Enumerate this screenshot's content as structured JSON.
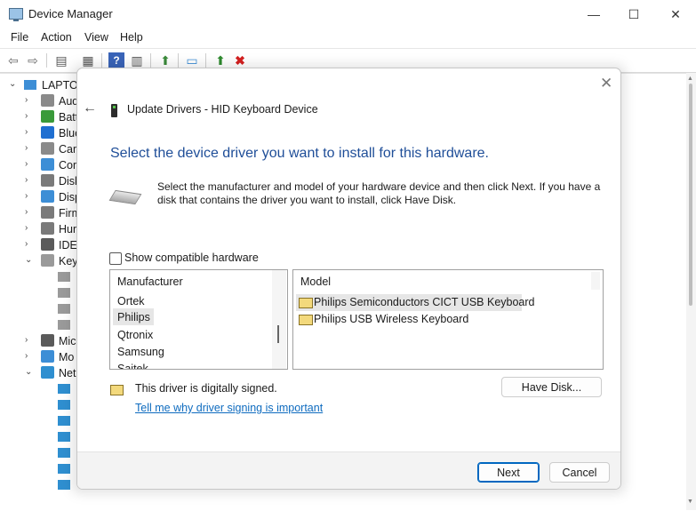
{
  "window": {
    "title": "Device Manager",
    "controls": {
      "minimize": "—",
      "maximize": "☐",
      "close": "✕"
    }
  },
  "menu": [
    {
      "label": "File"
    },
    {
      "label": "Action"
    },
    {
      "label": "View"
    },
    {
      "label": "Help"
    }
  ],
  "toolbar": [
    {
      "icon": "back-arrow-icon",
      "glyph": "⇦"
    },
    {
      "icon": "forward-arrow-icon",
      "glyph": "⇨"
    },
    {
      "icon": "properties-icon",
      "glyph": "▤"
    },
    {
      "icon": "list-icon",
      "glyph": "▦"
    },
    {
      "icon": "help-icon",
      "glyph": "?"
    },
    {
      "icon": "details-icon",
      "glyph": "▥"
    },
    {
      "icon": "update-driver-icon",
      "glyph": "⬆"
    },
    {
      "icon": "scan-hardware-icon",
      "glyph": "▭"
    },
    {
      "icon": "add-driver-icon",
      "glyph": "⬆"
    },
    {
      "icon": "uninstall-icon",
      "glyph": "✖"
    }
  ],
  "tree": {
    "root": {
      "label": "LAPTOP",
      "expander": "⌄"
    },
    "items": [
      {
        "label": "Aud",
        "expander": "›",
        "icon": "audio-icon",
        "color": "#8a8a8a"
      },
      {
        "label": "Batt",
        "expander": "›",
        "icon": "battery-icon",
        "color": "#3a9a3a"
      },
      {
        "label": "Blue",
        "expander": "›",
        "icon": "bluetooth-icon",
        "color": "#1f6fd1"
      },
      {
        "label": "Cam",
        "expander": "›",
        "icon": "camera-icon",
        "color": "#8a8a8a"
      },
      {
        "label": "Com",
        "expander": "›",
        "icon": "computer-icon",
        "color": "#3d8ed6"
      },
      {
        "label": "Disk",
        "expander": "›",
        "icon": "disk-icon",
        "color": "#7a7a7a"
      },
      {
        "label": "Disp",
        "expander": "›",
        "icon": "display-icon",
        "color": "#3d8ed6"
      },
      {
        "label": "Firm",
        "expander": "›",
        "icon": "firmware-icon",
        "color": "#7a7a7a"
      },
      {
        "label": "Hum",
        "expander": "›",
        "icon": "hid-icon",
        "color": "#7a7a7a"
      },
      {
        "label": "IDE",
        "expander": "›",
        "icon": "ide-icon",
        "color": "#5a5a5a"
      },
      {
        "label": "Key",
        "expander": "⌄",
        "icon": "keyboard-icon",
        "color": "#9a9a9a"
      },
      {
        "label": "",
        "expander": "",
        "icon": "keyboard-device-icon",
        "color": "#9a9a9a",
        "child": true
      },
      {
        "label": "",
        "expander": "",
        "icon": "keyboard-device-icon",
        "color": "#9a9a9a",
        "child": true
      },
      {
        "label": "",
        "expander": "",
        "icon": "keyboard-device-icon",
        "color": "#9a9a9a",
        "child": true
      },
      {
        "label": "",
        "expander": "",
        "icon": "keyboard-device-icon",
        "color": "#9a9a9a",
        "child": true
      },
      {
        "label": "Mic",
        "expander": "›",
        "icon": "mouse-icon",
        "color": "#5a5a5a"
      },
      {
        "label": "Mo",
        "expander": "›",
        "icon": "monitor-icon",
        "color": "#3d8ed6"
      },
      {
        "label": "Net",
        "expander": "⌄",
        "icon": "network-icon",
        "color": "#2f8fd0"
      },
      {
        "label": "",
        "expander": "",
        "icon": "network-adapter-icon",
        "color": "#2f8fd0",
        "child": true
      },
      {
        "label": "",
        "expander": "",
        "icon": "network-adapter-icon",
        "color": "#2f8fd0",
        "child": true
      },
      {
        "label": "",
        "expander": "",
        "icon": "network-adapter-icon",
        "color": "#2f8fd0",
        "child": true
      },
      {
        "label": "",
        "expander": "",
        "icon": "network-adapter-icon",
        "color": "#2f8fd0",
        "child": true
      },
      {
        "label": "",
        "expander": "",
        "icon": "network-adapter-icon",
        "color": "#2f8fd0",
        "child": true
      },
      {
        "label": "",
        "expander": "",
        "icon": "network-adapter-icon",
        "color": "#2f8fd0",
        "child": true
      },
      {
        "label": "",
        "expander": "",
        "icon": "network-adapter-icon",
        "color": "#2f8fd0",
        "child": true
      }
    ]
  },
  "dialog": {
    "close_glyph": "✕",
    "back_glyph": "←",
    "title": "Update Drivers - HID Keyboard Device",
    "heading": "Select the device driver you want to install for this hardware.",
    "description": "Select the manufacturer and model of your hardware device and then click Next. If you have a disk that contains the driver you want to install, click Have Disk.",
    "show_compatible_label": "Show compatible hardware",
    "show_compatible_checked": false,
    "manufacturer": {
      "header": "Manufacturer",
      "items": [
        "Ortek",
        "Philips",
        "Qtronix",
        "Samsung",
        "Saitek"
      ],
      "selected": "Philips"
    },
    "model": {
      "header": "Model",
      "items": [
        "Philips Semiconductors CICT USB Keyboard",
        "Philips USB Wireless Keyboard"
      ],
      "selected": "Philips Semiconductors CICT USB Keyboard"
    },
    "signed_text": "This driver is digitally signed.",
    "signing_link": "Tell me why driver signing is important",
    "have_disk_label": "Have Disk...",
    "next_label": "Next",
    "cancel_label": "Cancel",
    "accent_color": "#0067c0",
    "heading_color": "#1f4e98",
    "link_color": "#0e6bbf"
  }
}
